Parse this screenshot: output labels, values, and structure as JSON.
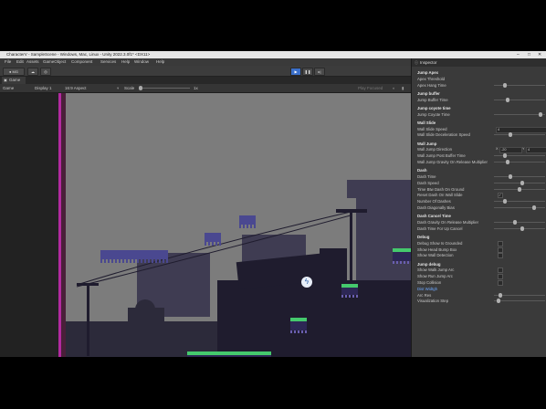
{
  "window": {
    "title": "CharacterV - SampleScene - Windows, Mac, Linux - Unity 2022.3.0f1* <DX11>",
    "controls": [
      "–",
      "□",
      "✕"
    ]
  },
  "menubar": [
    "File",
    "Edit",
    "Assets",
    "GameObject",
    "Component",
    "Services",
    "Help",
    "Window",
    "Help"
  ],
  "toolbar": {
    "account": "MG",
    "play_icon": "play-icon",
    "pause_icon": "pause-icon",
    "step_icon": "step-icon"
  },
  "tabs": {
    "game": "Game"
  },
  "game_toolbar": {
    "mode": "Game",
    "display": "Display 1",
    "aspect": "16:9 Aspect",
    "scale_label": "Scale",
    "scale_value": "1x",
    "play_focused": "Play Focused"
  },
  "inspector": {
    "tab": "Inspector",
    "rows": [
      {
        "type": "header",
        "label": "Jump Apex"
      },
      {
        "type": "field",
        "label": "Apex Threshold",
        "control": "none"
      },
      {
        "type": "field",
        "label": "Apex Hang Time",
        "control": "slider",
        "value": 0.2
      },
      {
        "type": "spacer"
      },
      {
        "type": "header",
        "label": "Jump buffer"
      },
      {
        "type": "field",
        "label": "Jump Buffer Time",
        "control": "slider",
        "value": 0.25
      },
      {
        "type": "spacer"
      },
      {
        "type": "header",
        "label": "Jump coyote time"
      },
      {
        "type": "field",
        "label": "Jump Coyote Time",
        "control": "slider",
        "value": 0.95
      },
      {
        "type": "spacer"
      },
      {
        "type": "header",
        "label": "Wall Slide"
      },
      {
        "type": "field",
        "label": "Wall Slide Speed",
        "control": "number",
        "value": "4"
      },
      {
        "type": "field",
        "label": "Wall Slide Deceleration Speed",
        "control": "slider",
        "value": 0.3
      },
      {
        "type": "spacer"
      },
      {
        "type": "header",
        "label": "Wall Jump"
      },
      {
        "type": "field",
        "label": "Wall Jump Direction",
        "control": "vector",
        "x": "-20",
        "y": "4"
      },
      {
        "type": "field",
        "label": "Wall Jump Post Buffer Time",
        "control": "slider",
        "value": 0.2
      },
      {
        "type": "field",
        "label": "Wall Jump Gravity On Release Multiplier",
        "control": "slider",
        "value": 0.25
      },
      {
        "type": "spacer"
      },
      {
        "type": "header",
        "label": "Dash"
      },
      {
        "type": "field",
        "label": "Dash Time",
        "control": "slider",
        "value": 0.3
      },
      {
        "type": "field",
        "label": "Dash Speed",
        "control": "slider",
        "value": 0.55
      },
      {
        "type": "field",
        "label": "Time Btw Dash On Ground",
        "control": "slider",
        "value": 0.5
      },
      {
        "type": "field",
        "label": "Reset Dash On Wall Slide",
        "control": "checkbox",
        "checked": true
      },
      {
        "type": "field",
        "label": "Number Of Dashes",
        "control": "slider",
        "value": 0.2
      },
      {
        "type": "field",
        "label": "Dash Diagonally Bias",
        "control": "slider",
        "value": 0.8
      },
      {
        "type": "spacer"
      },
      {
        "type": "header",
        "label": "Dash Cancel Time"
      },
      {
        "type": "field",
        "label": "Dash Gravity On Release Multiplier",
        "control": "slider",
        "value": 0.4
      },
      {
        "type": "field",
        "label": "Dash Time For Up Cancel",
        "control": "slider",
        "value": 0.55
      },
      {
        "type": "spacer"
      },
      {
        "type": "header",
        "label": "Debug"
      },
      {
        "type": "field",
        "label": "Debug Show Is Grounded",
        "control": "checkbox",
        "checked": false
      },
      {
        "type": "field",
        "label": "Show Head Bump Box",
        "control": "checkbox",
        "checked": false
      },
      {
        "type": "field",
        "label": "Show Wall Detection",
        "control": "checkbox",
        "checked": false
      },
      {
        "type": "spacer"
      },
      {
        "type": "header",
        "label": "Jump debug"
      },
      {
        "type": "field",
        "label": "Show Walk Jump Arc",
        "control": "checkbox",
        "checked": false
      },
      {
        "type": "field",
        "label": "Show Run Jump Arc",
        "control": "checkbox",
        "checked": false
      },
      {
        "type": "field",
        "label": "Stop Collision",
        "control": "checkbox",
        "checked": false
      },
      {
        "type": "link",
        "label": "Dist Widtgh",
        "control": "none"
      },
      {
        "type": "field",
        "label": "Arc Res",
        "control": "slider",
        "value": 0.1
      },
      {
        "type": "field",
        "label": "Visualization Step",
        "control": "slider",
        "value": 0.05
      }
    ]
  },
  "scene": {
    "sky_color": "#7c7c7c",
    "silhouette_far": "#3f3c52",
    "silhouette_mid": "#2c2a3a",
    "silhouette_near": "#1f1c2e",
    "grass_color": "#45c96d",
    "ground_tile_color": "#4a5ba8",
    "player_icon": "lightning-icon"
  }
}
